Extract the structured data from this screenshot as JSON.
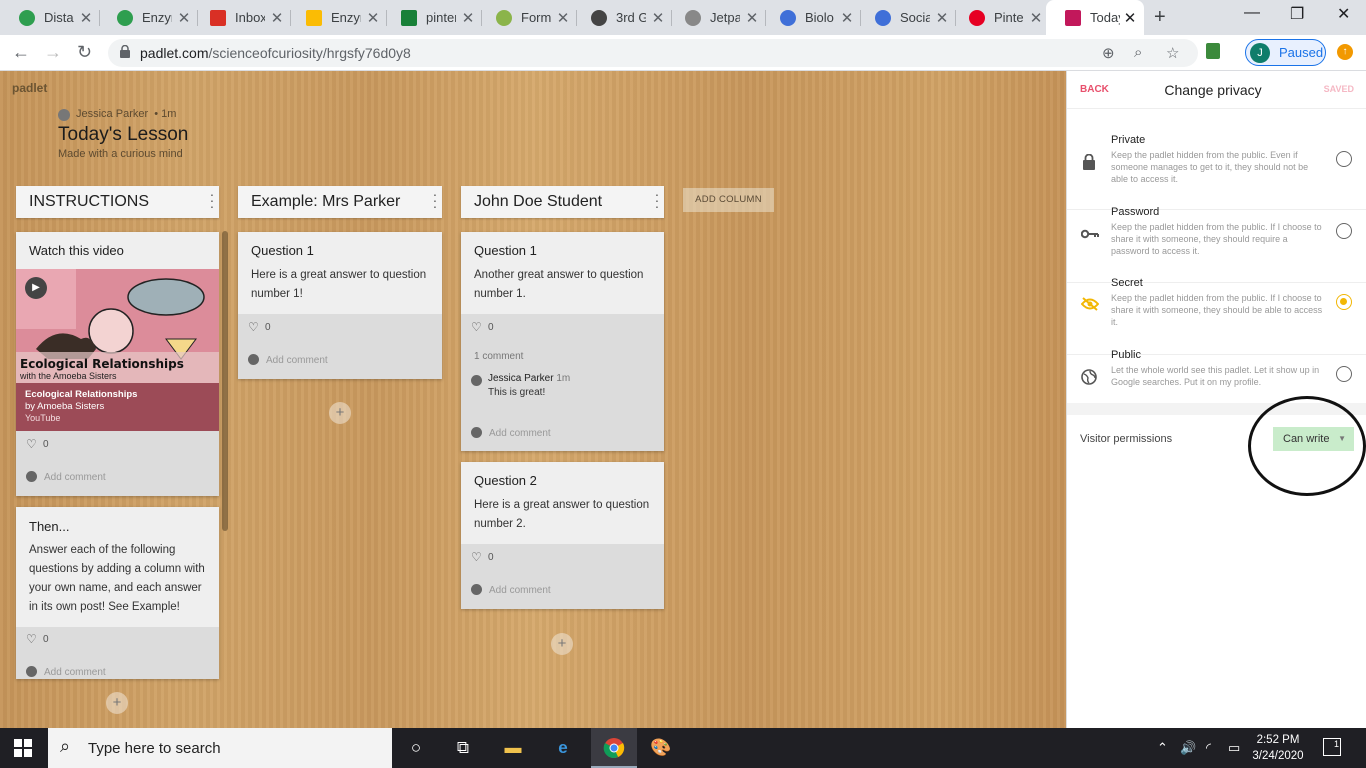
{
  "browser": {
    "tabs": [
      {
        "label": "Distan",
        "favicon_color": "#2e9e4f"
      },
      {
        "label": "Enzym",
        "favicon_color": "#2e9e4f"
      },
      {
        "label": "Inbox",
        "favicon_color": "#d93025"
      },
      {
        "label": "Enzym",
        "favicon_color": "#fbbc04"
      },
      {
        "label": "pinter",
        "favicon_color": "#188038"
      },
      {
        "label": "Forms",
        "favicon_color": "#8bb44a"
      },
      {
        "label": "3rd G",
        "favicon_color": "#444444"
      },
      {
        "label": "Jetpa",
        "favicon_color": "#888888"
      },
      {
        "label": "Biolo",
        "favicon_color": "#3f6fd8"
      },
      {
        "label": "Social",
        "favicon_color": "#3f6fd8"
      },
      {
        "label": "Pinter",
        "favicon_color": "#e60023"
      },
      {
        "label": "Today",
        "favicon_color": "#c2185b",
        "active": true
      }
    ],
    "new_tab": "+",
    "window_controls": {
      "minimize": "—",
      "maximize": "❐",
      "close": "✕"
    },
    "url_host": "padlet.com",
    "url_path": "/scienceofcuriosity/hrgsfy76d0y8",
    "profile_initial": "J",
    "profile_status": "Paused"
  },
  "board": {
    "logo": "padlet",
    "author": "Jessica Parker",
    "author_time": "• 1m",
    "title": "Today's Lesson",
    "subtitle": "Made with a curious mind",
    "add_column_label": "ADD COLUMN",
    "columns": [
      {
        "title": "INSTRUCTIONS"
      },
      {
        "title": "Example: Mrs Parker"
      },
      {
        "title": "John Doe Student"
      }
    ],
    "cards": {
      "watch": {
        "title": "Watch this video",
        "video_caption": "Ecological Relationships",
        "video_caption_sub": "with the Amoeba Sisters",
        "video_title": "Ecological Relationships",
        "video_author": "by Amoeba Sisters",
        "video_source": "YouTube",
        "likes": "0",
        "add_comment": "Add comment"
      },
      "then": {
        "title": "Then...",
        "body": "Answer each of the following questions by adding a column with your own name, and each answer in its own post! See Example!",
        "likes": "0",
        "add_comment": "Add comment"
      },
      "mrs_q1": {
        "title": "Question 1",
        "body": "Here is a great answer to question number 1!",
        "likes": "0",
        "add_comment": "Add comment"
      },
      "john_q1": {
        "title": "Question 1",
        "body": "Another great answer to question number 1.",
        "likes": "0",
        "comment_count": "1 comment",
        "commenter": "Jessica Parker",
        "comment_time": "1m",
        "comment_text": "This is great!",
        "add_comment": "Add comment"
      },
      "john_q2": {
        "title": "Question 2",
        "body": "Here is a great answer to question number 2.",
        "likes": "0",
        "add_comment": "Add comment"
      }
    }
  },
  "privacy_panel": {
    "back": "BACK",
    "title": "Change privacy",
    "saved": "SAVED",
    "options": [
      {
        "name": "Private",
        "desc": "Keep the padlet hidden from the public. Even if someone manages to get to it, they should not be able to access it.",
        "icon": "lock-icon",
        "selected": false
      },
      {
        "name": "Password",
        "desc": "Keep the padlet hidden from the public. If I choose to share it with someone, they should require a password to access it.",
        "icon": "key-icon",
        "selected": false
      },
      {
        "name": "Secret",
        "desc": "Keep the padlet hidden from the public. If I choose to share it with someone, they should be able to access it.",
        "icon": "eye-slash-icon",
        "selected": true
      },
      {
        "name": "Public",
        "desc": "Let the whole world see this padlet. Let it show up in Google searches. Put it on my profile.",
        "icon": "globe-icon",
        "selected": false
      }
    ],
    "visitor_permissions_label": "Visitor permissions",
    "visitor_permissions_value": "Can write",
    "accent_color": "#f2b705"
  },
  "taskbar": {
    "search_placeholder": "Type here to search",
    "time": "2:52 PM",
    "date": "3/24/2020",
    "notification_count": "1"
  }
}
